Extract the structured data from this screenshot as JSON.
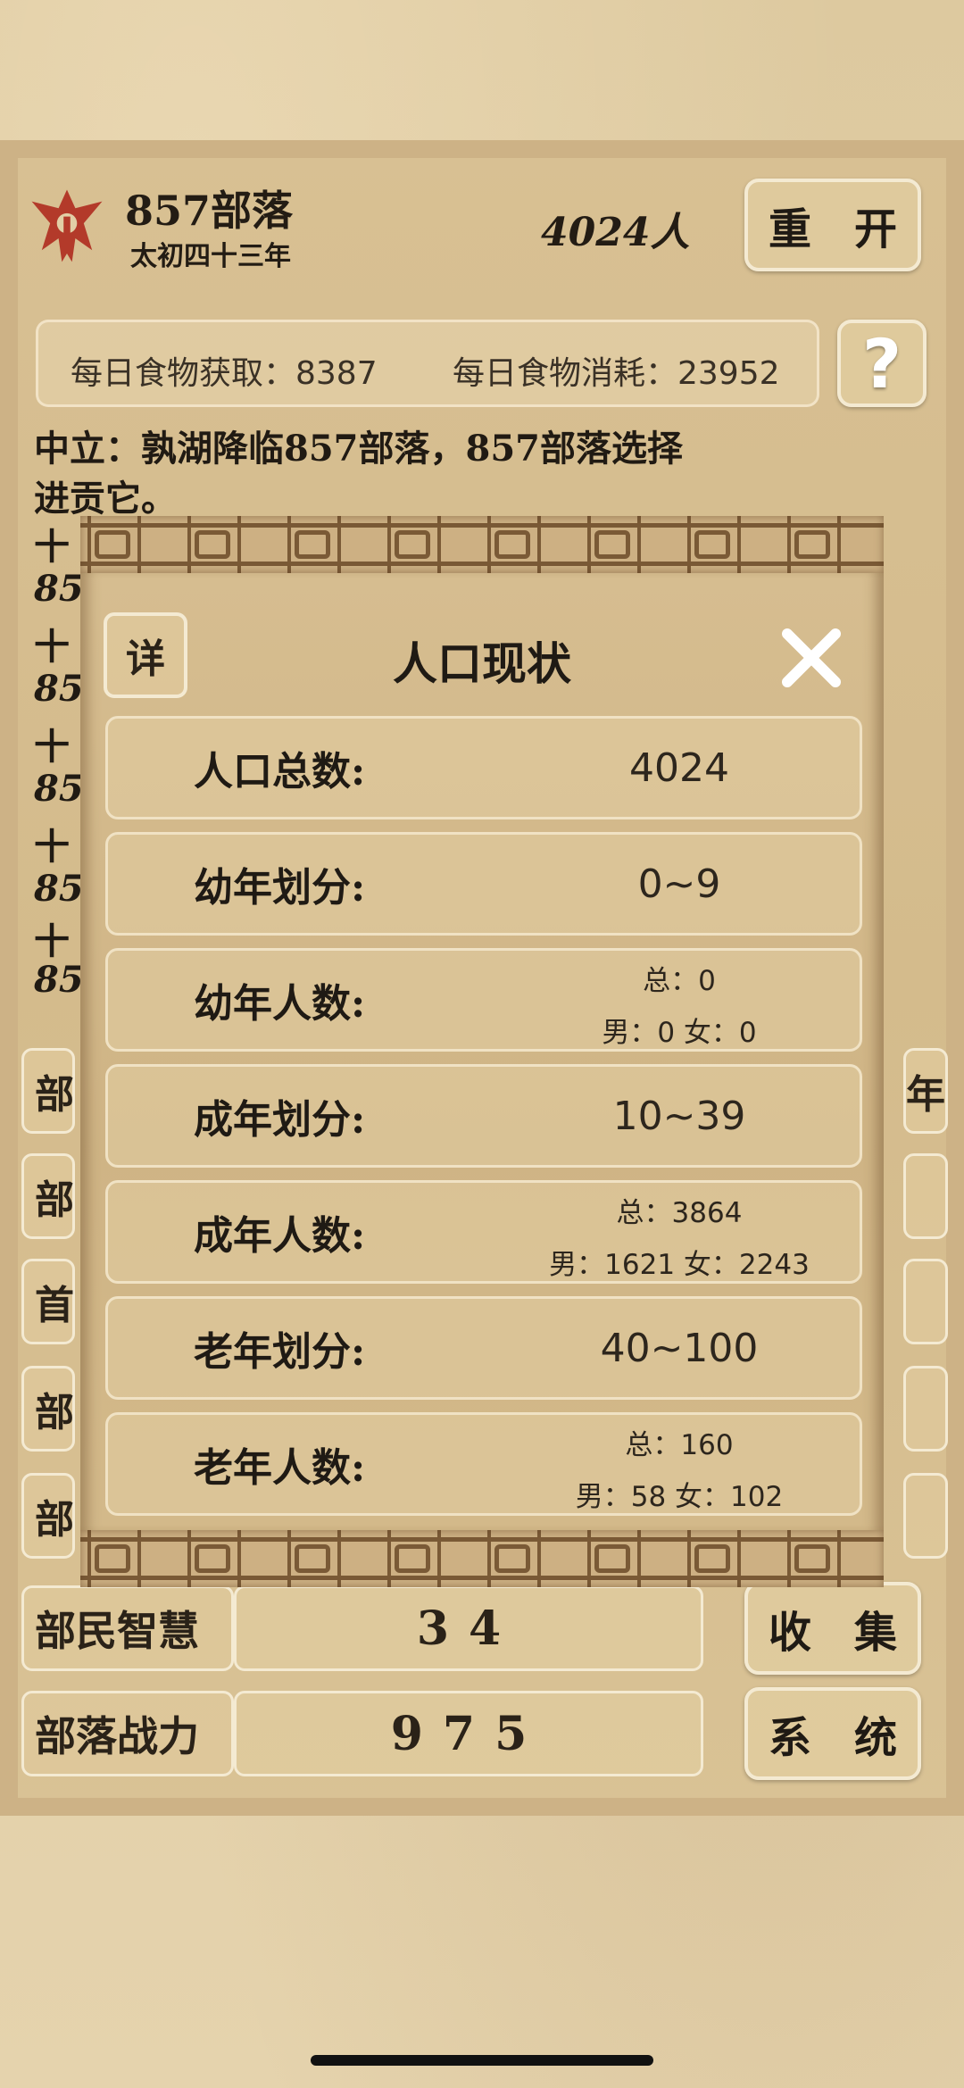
{
  "header": {
    "tribe_name": "857部落",
    "era": "太初四十三年",
    "population": "4024人",
    "restart_label": "重　开"
  },
  "food": {
    "daily_gain": "每日食物获取：8387",
    "daily_cost": "每日食物消耗：23952",
    "help_label": "?"
  },
  "log": {
    "line1": "中立：孰湖降临857部落，857部落选择",
    "line2": "进贡它。",
    "partial": [
      "十",
      "85",
      "十",
      "85",
      "十",
      "85",
      "十",
      "85",
      "十",
      "85"
    ]
  },
  "left_tabs": [
    "部",
    "部",
    "首",
    "部",
    "部"
  ],
  "right_tabs": [
    "年",
    "",
    "",
    "",
    ""
  ],
  "stats": {
    "wisdom_label": "部民智慧",
    "wisdom_value": "34",
    "power_label": "部落战力",
    "power_value": "975"
  },
  "buttons": {
    "collect": "收　集",
    "system": "系　统"
  },
  "modal": {
    "title": "人口现状",
    "detail_label": "详",
    "rows": [
      {
        "label": "人口总数:",
        "value": "4024"
      },
      {
        "label": "幼年划分:",
        "value": "0~9"
      },
      {
        "label": "幼年人数:",
        "total": "总：0",
        "split": "男：0 女：0"
      },
      {
        "label": "成年划分:",
        "value": "10~39"
      },
      {
        "label": "成年人数:",
        "total": "总：3864",
        "split": "男：1621 女：2243"
      },
      {
        "label": "老年划分:",
        "value": "40~100"
      },
      {
        "label": "老年人数:",
        "total": "总：160",
        "split": "男：58 女：102"
      }
    ]
  },
  "colors": {
    "parchment": "#d6bd90",
    "border_ink": "#7a5a36",
    "logo_red": "#b33a2a"
  }
}
